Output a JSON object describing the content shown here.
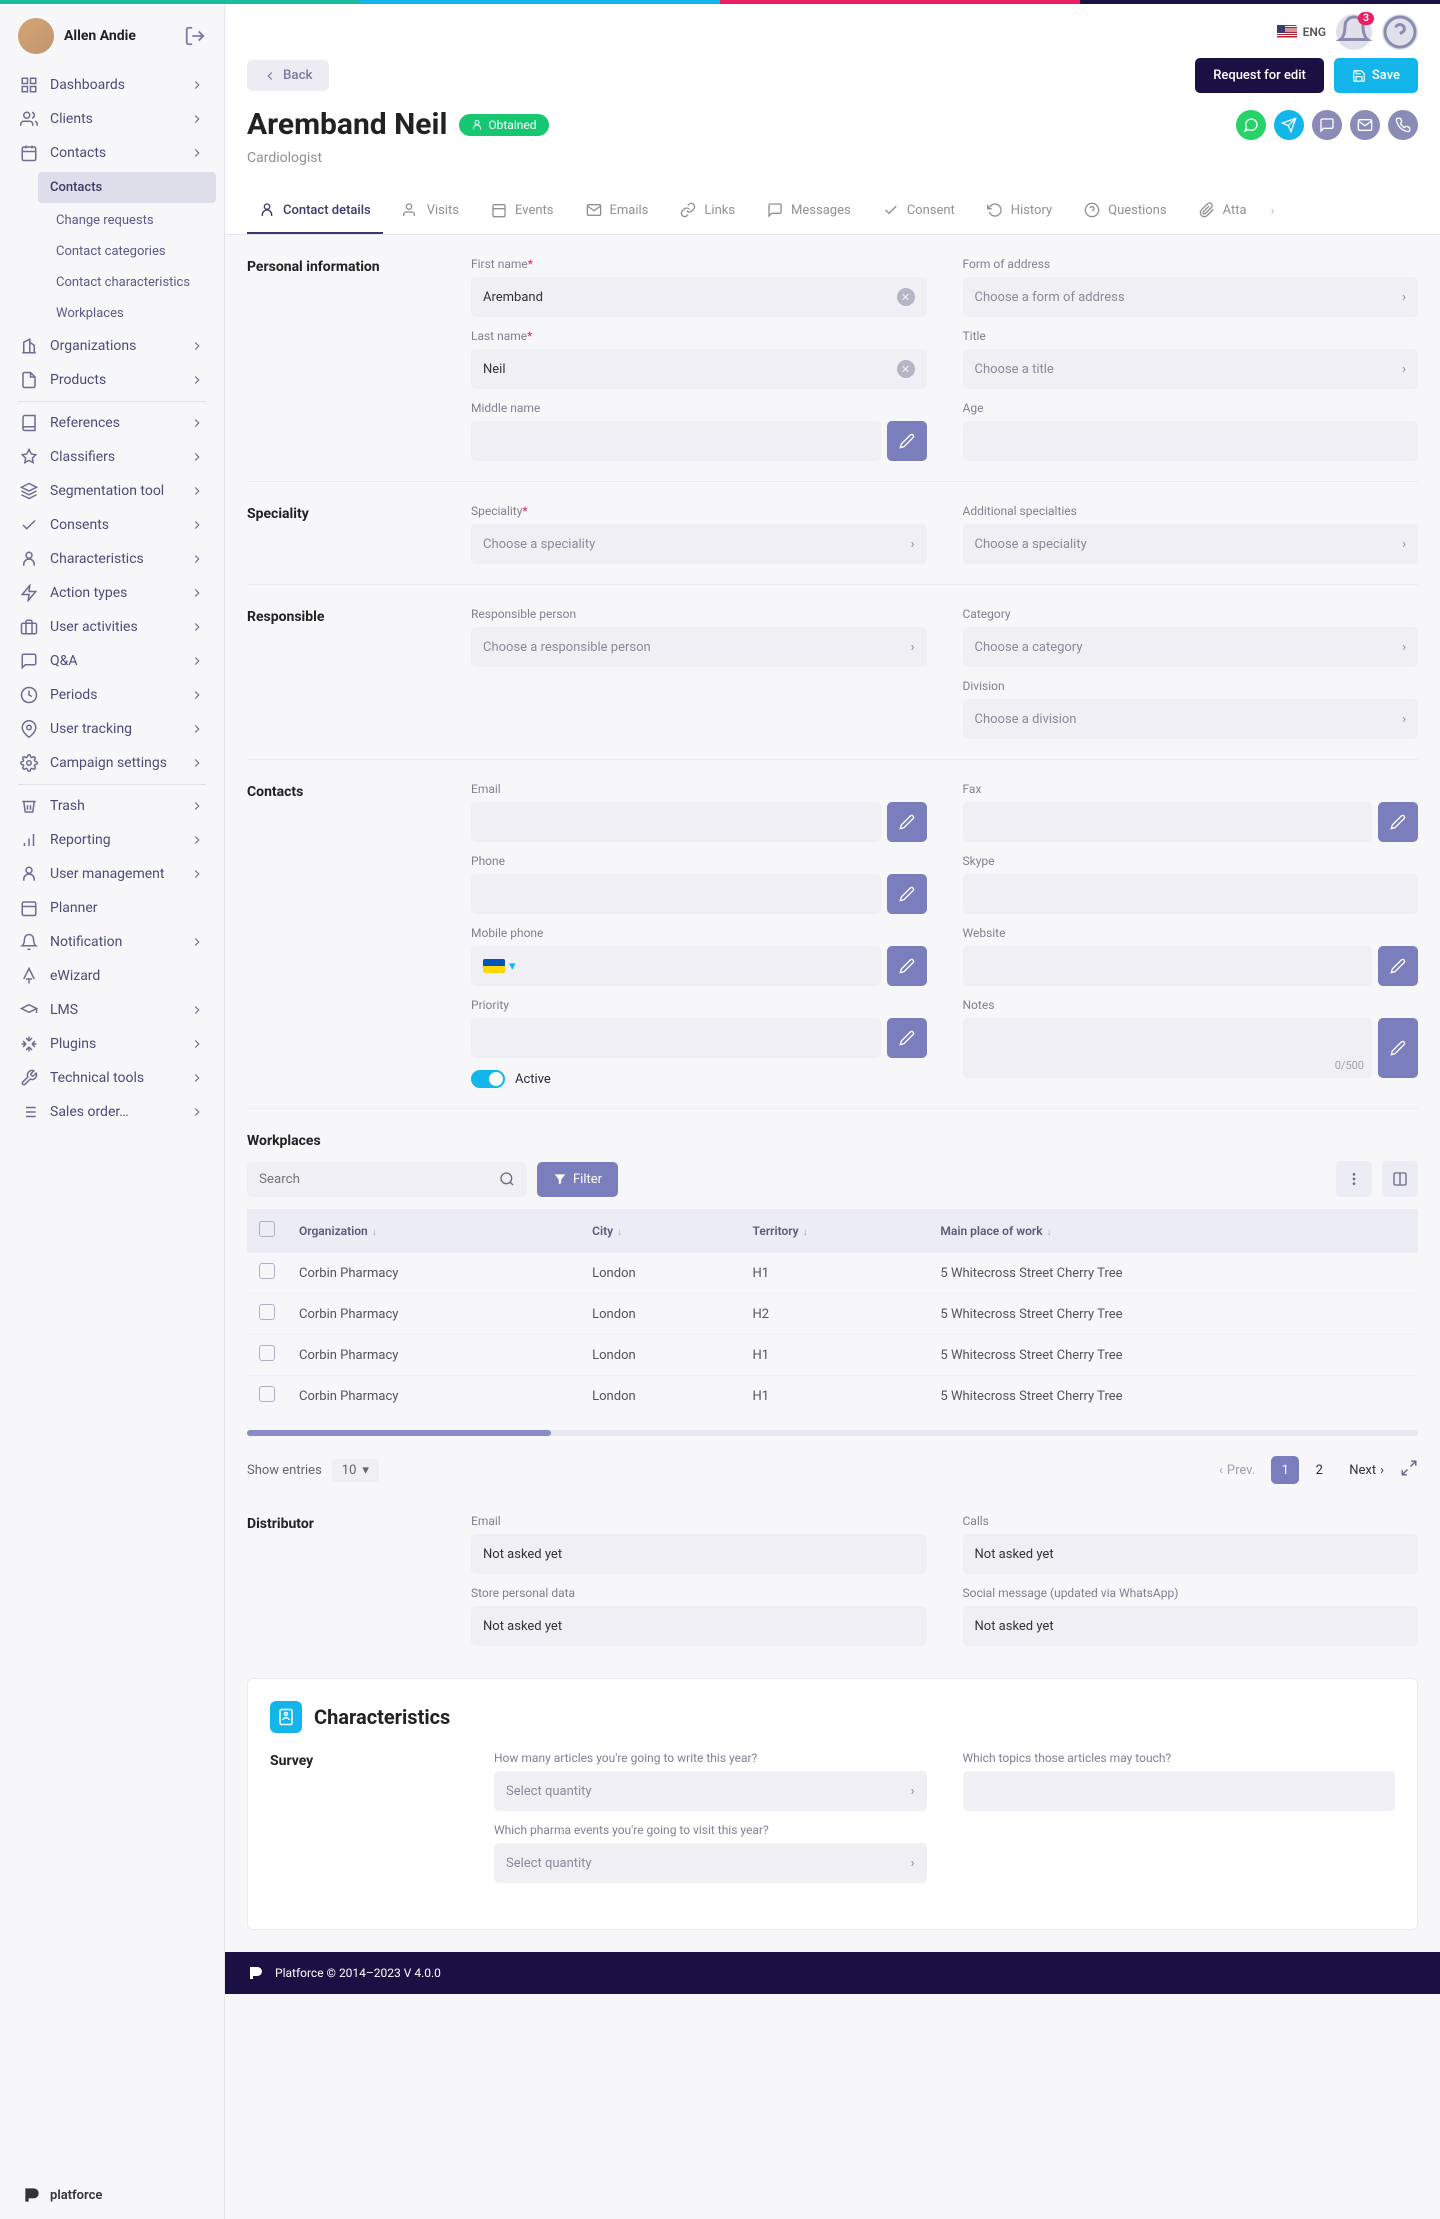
{
  "user": {
    "name": "Allen Andie"
  },
  "header": {
    "lang": "ENG",
    "notifications_count": "3",
    "back": "Back",
    "request_edit": "Request for edit",
    "save": "Save",
    "title": "Aremband Neil",
    "status": "Obtained",
    "subtitle": "Cardiologist"
  },
  "nav": {
    "dashboards": "Dashboards",
    "clients": "Clients",
    "contacts": "Contacts",
    "contacts_sub": [
      "Contacts",
      "Change requests",
      "Contact categories",
      "Contact characteristics",
      "Workplaces"
    ],
    "organizations": "Organizations",
    "products": "Products",
    "references": "References",
    "classifiers": "Classifiers",
    "segmentation": "Segmentation tool",
    "consents": "Consents",
    "characteristics": "Characteristics",
    "action_types": "Action types",
    "user_activities": "User activities",
    "qa": "Q&A",
    "periods": "Periods",
    "user_tracking": "User tracking",
    "campaign": "Campaign settings",
    "trash": "Trash",
    "reporting": "Reporting",
    "user_mgmt": "User management",
    "planner": "Planner",
    "notification": "Notification",
    "ewizard": "eWizard",
    "lms": "LMS",
    "plugins": "Plugins",
    "tech": "Technical tools",
    "sales": "Sales order…"
  },
  "tabs": [
    "Contact details",
    "Visits",
    "Events",
    "Emails",
    "Links",
    "Messages",
    "Consent",
    "History",
    "Questions",
    "Atta"
  ],
  "sections": {
    "personal": {
      "label": "Personal information",
      "first_name_label": "First name",
      "last_name_label": "Last name",
      "middle_name_label": "Middle name",
      "form_of_address_label": "Form of address",
      "title_label": "Title",
      "age_label": "Age",
      "first_name": "Aremband",
      "last_name": "Neil",
      "form_placeholder": "Choose a form of address",
      "title_placeholder": "Choose a title"
    },
    "speciality": {
      "label": "Speciality",
      "spec_label": "Speciality",
      "addl_label": "Additional specialties",
      "placeholder": "Choose a speciality"
    },
    "responsible": {
      "label": "Responsible",
      "person_label": "Responsible person",
      "person_ph": "Choose a responsible person",
      "category_label": "Category",
      "category_ph": "Choose a category",
      "division_label": "Division",
      "division_ph": "Choose a division"
    },
    "contacts": {
      "label": "Contacts",
      "email": "Email",
      "phone": "Phone",
      "mobile": "Mobile phone",
      "priority": "Priority",
      "fax": "Fax",
      "skype": "Skype",
      "website": "Website",
      "notes": "Notes",
      "active": "Active",
      "charcount": "0/500"
    },
    "workplaces": {
      "label": "Workplaces",
      "search_ph": "Search",
      "filter": "Filter",
      "cols": {
        "org": "Organization",
        "city": "City",
        "terr": "Territory",
        "main": "Main place of work"
      },
      "rows": [
        {
          "org": "Corbin Pharmacy",
          "city": "London",
          "terr": "H1",
          "main": "5 Whitecross Street Cherry Tree"
        },
        {
          "org": "Corbin Pharmacy",
          "city": "London",
          "terr": "H2",
          "main": "5 Whitecross Street Cherry Tree"
        },
        {
          "org": "Corbin Pharmacy",
          "city": "London",
          "terr": "H1",
          "main": "5 Whitecross Street Cherry Tree"
        },
        {
          "org": "Corbin Pharmacy",
          "city": "London",
          "terr": "H1",
          "main": "5 Whitecross Street Cherry Tree"
        }
      ],
      "show_entries": "Show entries",
      "show_val": "10",
      "prev": "Prev.",
      "next": "Next"
    },
    "distributor": {
      "label": "Distributor",
      "email": "Email",
      "calls": "Calls",
      "store": "Store personal data",
      "social": "Social message (updated via WhatsApp)",
      "not_asked": "Not asked yet"
    },
    "chars": {
      "title": "Characteristics",
      "survey": "Survey",
      "q1": "How many articles you're going to write this year?",
      "q2": "Which topics those articles may touch?",
      "q3": "Which pharma events you're going to visit this year?",
      "select_ph": "Select quantity"
    }
  },
  "footer": {
    "brand": "platforce",
    "copyright": "Platforce © 2014–2023 V 4.0.0"
  }
}
